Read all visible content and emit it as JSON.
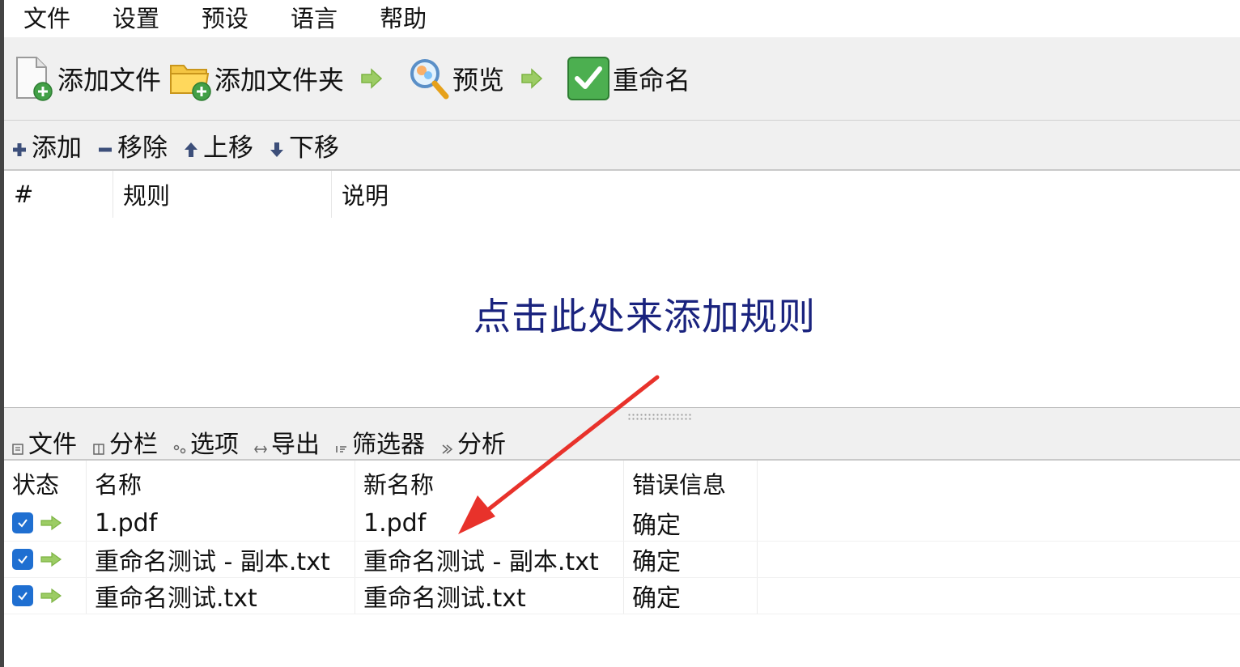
{
  "menu": [
    "文件",
    "设置",
    "预设",
    "语言",
    "帮助"
  ],
  "toolbar": {
    "add_file": "添加文件",
    "add_folder": "添加文件夹",
    "preview": "预览",
    "rename": "重命名"
  },
  "rules_toolbar": {
    "add": "添加",
    "remove": "移除",
    "move_up": "上移",
    "move_down": "下移"
  },
  "rules_table": {
    "columns": [
      "#",
      "规则",
      "说明"
    ],
    "placeholder": "点击此处来添加规则"
  },
  "files_toolbar": {
    "files": "文件",
    "columns": "分栏",
    "options": "选项",
    "export": "导出",
    "filter": "筛选器",
    "analyze": "分析"
  },
  "files_table": {
    "columns": [
      "状态",
      "名称",
      "新名称",
      "错误信息"
    ],
    "rows": [
      {
        "name": "1.pdf",
        "new_name": "1.pdf",
        "error": "确定"
      },
      {
        "name": "重命名测试 - 副本.txt",
        "new_name": "重命名测试 - 副本.txt",
        "error": "确定"
      },
      {
        "name": "重命名测试.txt",
        "new_name": "重命名测试.txt",
        "error": "确定"
      }
    ]
  },
  "colors": {
    "toolbar_bg": "#f0f0f0",
    "placeholder_text": "#1a237e",
    "checkbox": "#1f6fd1",
    "status_arrow": "#7cc13c",
    "annotation_arrow": "#e8322b",
    "rename_icon": "#4caf50"
  },
  "icons": {
    "add_file": "document-plus-icon",
    "add_folder": "folder-plus-icon",
    "preview": "magnifier-icon",
    "rename": "green-check-icon",
    "separator": "green-arrow-icon"
  }
}
